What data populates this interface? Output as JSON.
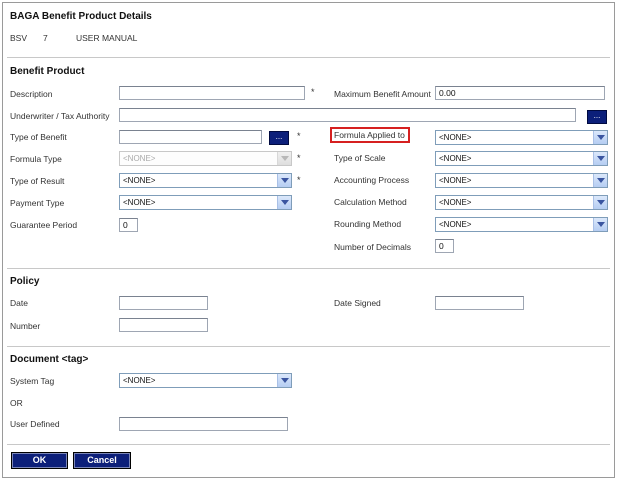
{
  "header": {
    "title": "BAGA Benefit Product Details",
    "code": "BSV",
    "number": "7",
    "manual": "USER MANUAL"
  },
  "benefit_product": {
    "section_title": "Benefit Product",
    "description_label": "Description",
    "description_value": "",
    "underwriter_label": "Underwriter / Tax Authority",
    "underwriter_value": "",
    "type_of_benefit_label": "Type of Benefit",
    "type_of_benefit_value": "",
    "formula_type_label": "Formula Type",
    "formula_type_value": "<NONE>",
    "type_of_result_label": "Type of Result",
    "type_of_result_value": "<NONE>",
    "payment_type_label": "Payment Type",
    "payment_type_value": "<NONE>",
    "guarantee_period_label": "Guarantee Period",
    "guarantee_period_value": "0",
    "max_benefit_label": "Maximum Benefit Amount",
    "max_benefit_value": "0.00",
    "formula_applied_label": "Formula Applied to",
    "formula_applied_value": "<NONE>",
    "type_of_scale_label": "Type of Scale",
    "type_of_scale_value": "<NONE>",
    "accounting_process_label": "Accounting Process",
    "accounting_process_value": "<NONE>",
    "calculation_method_label": "Calculation Method",
    "calculation_method_value": "<NONE>",
    "rounding_method_label": "Rounding Method",
    "rounding_method_value": "<NONE>",
    "decimals_label": "Number of Decimals",
    "decimals_value": "0",
    "required_mark": "*",
    "lookup_label": "..."
  },
  "policy": {
    "section_title": "Policy",
    "date_label": "Date",
    "date_value": "",
    "number_label": "Number",
    "number_value": "",
    "date_signed_label": "Date Signed",
    "date_signed_value": ""
  },
  "document": {
    "section_title": "Document <tag>",
    "system_tag_label": "System Tag",
    "system_tag_value": "<NONE>",
    "or_label": "OR",
    "user_defined_label": "User Defined",
    "user_defined_value": ""
  },
  "actions": {
    "ok_label": "OK",
    "cancel_label": "Cancel"
  },
  "colors": {
    "button_bg": "#0c1f7a",
    "highlight": "#d62020",
    "dropdown_border": "#7f9db9"
  }
}
